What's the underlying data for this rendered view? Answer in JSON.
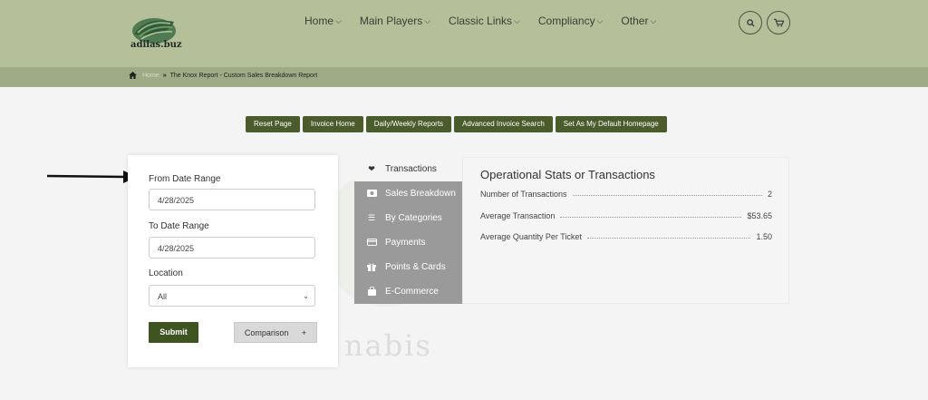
{
  "header": {
    "logo_text": "adilas.buz",
    "nav": [
      "Home",
      "Main Players",
      "Classic Links",
      "Compliancy",
      "Other"
    ]
  },
  "breadcrumb": {
    "home": "Home",
    "current": "The Knox Report - Custom Sales Breakdown Report"
  },
  "toolbar": [
    "Reset Page",
    "Invoice Home",
    "Daily/Weekly Reports",
    "Advanced Invoice Search",
    "Set As My Default Homepage"
  ],
  "form": {
    "from_label": "From Date Range",
    "from_value": "4/28/2025",
    "to_label": "To Date Range",
    "to_value": "4/28/2025",
    "location_label": "Location",
    "location_value": "All",
    "submit_label": "Submit",
    "comparison_label": "Comparison",
    "comparison_plus": "+"
  },
  "tabs": [
    {
      "label": "Transactions",
      "icon": "heartbeat-icon"
    },
    {
      "label": "Sales Breakdown",
      "icon": "money-icon"
    },
    {
      "label": "By Categories",
      "icon": "list-icon"
    },
    {
      "label": "Payments",
      "icon": "credit-card-icon"
    },
    {
      "label": "Points & Cards",
      "icon": "gift-icon"
    },
    {
      "label": "E-Commerce",
      "icon": "shopping-bag-icon"
    }
  ],
  "panel": {
    "title": "Operational Stats or Transactions",
    "stats": [
      {
        "label": "Number of Transactions",
        "value": "2"
      },
      {
        "label": "Average Transaction",
        "value": "$53.65"
      },
      {
        "label": "Average Quantity Per Ticket",
        "value": "1.50"
      }
    ]
  },
  "watermark": "nabis",
  "colors": {
    "header": "#b5bf9a",
    "breadcrumb_bar": "#9fab86",
    "button_green": "#4a5b2c",
    "tab_gray": "#9a9a9a"
  }
}
